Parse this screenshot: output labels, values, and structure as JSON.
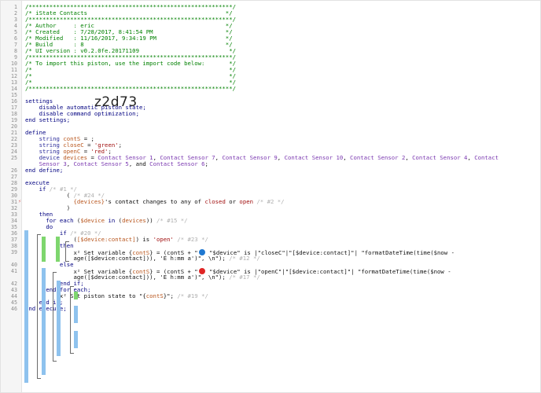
{
  "lines": [
    {
      "n": "1",
      "segs": [
        {
          "c": "cm",
          "t": "/***********************************************************/"
        }
      ]
    },
    {
      "n": "2",
      "segs": [
        {
          "c": "cm",
          "t": "/* iState Contacts                                        */"
        }
      ]
    },
    {
      "n": "3",
      "segs": [
        {
          "c": "cm",
          "t": "/***********************************************************/"
        }
      ]
    },
    {
      "n": "4",
      "segs": [
        {
          "c": "cm",
          "t": "/* Author     : eric                                      */"
        }
      ]
    },
    {
      "n": "5",
      "segs": [
        {
          "c": "cm",
          "t": "/* Created    : 7/28/2017, 8:41:54 PM                     */"
        }
      ]
    },
    {
      "n": "6",
      "segs": [
        {
          "c": "cm",
          "t": "/* Modified   : 11/16/2017, 9:34:19 PM                    */"
        }
      ]
    },
    {
      "n": "7",
      "segs": [
        {
          "c": "cm",
          "t": "/* Build      : 8                                         */"
        }
      ]
    },
    {
      "n": "8",
      "segs": [
        {
          "c": "cm",
          "t": "/* UI version : v0.2.0fe.20171109                          */"
        }
      ]
    },
    {
      "n": "9",
      "segs": [
        {
          "c": "cm",
          "t": "/***********************************************************/"
        }
      ]
    },
    {
      "n": "10",
      "segs": [
        {
          "c": "cm",
          "t": "/* To import this piston, use the import code below:       */"
        }
      ]
    },
    {
      "n": "11",
      "segs": [
        {
          "c": "cm",
          "t": "/*                                                         */"
        }
      ]
    },
    {
      "n": "12",
      "segs": [
        {
          "c": "cm",
          "t": "/*                                                         */"
        }
      ]
    },
    {
      "n": "13",
      "segs": [
        {
          "c": "cm",
          "t": "/*                                                         */"
        }
      ]
    },
    {
      "n": "14",
      "segs": [
        {
          "c": "cm",
          "t": "/***********************************************************/"
        }
      ]
    },
    {
      "n": "15",
      "segs": []
    },
    {
      "n": "16",
      "segs": [
        {
          "c": "kw",
          "t": "settings"
        }
      ]
    },
    {
      "n": "17",
      "segs": [
        {
          "c": "kw",
          "t": "    disable automatic piston state;"
        }
      ]
    },
    {
      "n": "18",
      "segs": [
        {
          "c": "kw",
          "t": "    disable command optimization;"
        }
      ]
    },
    {
      "n": "19",
      "segs": [
        {
          "c": "kw",
          "t": "end settings;"
        }
      ]
    },
    {
      "n": "20",
      "segs": []
    },
    {
      "n": "21",
      "segs": [
        {
          "c": "kw",
          "t": "define"
        }
      ]
    },
    {
      "n": "22",
      "segs": [
        {
          "c": "lit",
          "t": "    string "
        },
        {
          "c": "var",
          "t": "contS"
        },
        {
          "c": "plain",
          "t": " = ;"
        }
      ]
    },
    {
      "n": "23",
      "segs": [
        {
          "c": "lit",
          "t": "    string "
        },
        {
          "c": "var",
          "t": "closeC"
        },
        {
          "c": "plain",
          "t": " = "
        },
        {
          "c": "str",
          "t": "'green'"
        },
        {
          "c": "plain",
          "t": ";"
        }
      ]
    },
    {
      "n": "24",
      "segs": [
        {
          "c": "lit",
          "t": "    string "
        },
        {
          "c": "var",
          "t": "openC"
        },
        {
          "c": "plain",
          "t": " = "
        },
        {
          "c": "str",
          "t": "'red'"
        },
        {
          "c": "plain",
          "t": ";"
        }
      ]
    },
    {
      "n": "25",
      "segs": [
        {
          "c": "lit",
          "t": "    device "
        },
        {
          "c": "var",
          "t": "devices"
        },
        {
          "c": "plain",
          "t": " = "
        },
        {
          "c": "dev",
          "t": "Contact Sensor 1"
        },
        {
          "c": "plain",
          "t": ", "
        },
        {
          "c": "dev",
          "t": "Contact Sensor 7"
        },
        {
          "c": "plain",
          "t": ", "
        },
        {
          "c": "dev",
          "t": "Contact Sensor 9"
        },
        {
          "c": "plain",
          "t": ", "
        },
        {
          "c": "dev",
          "t": "Contact Sensor 10"
        },
        {
          "c": "plain",
          "t": ", "
        },
        {
          "c": "dev",
          "t": "Contact Sensor 2"
        },
        {
          "c": "plain",
          "t": ", "
        },
        {
          "c": "dev",
          "t": "Contact Sensor 4"
        },
        {
          "c": "plain",
          "t": ", "
        },
        {
          "c": "dev",
          "t": "Contact"
        }
      ]
    },
    {
      "n": "",
      "segs": [
        {
          "c": "dev",
          "t": "    Sensor 3"
        },
        {
          "c": "plain",
          "t": ", "
        },
        {
          "c": "dev",
          "t": "Contact Sensor 5"
        },
        {
          "c": "plain",
          "t": ", and "
        },
        {
          "c": "dev",
          "t": "Contact Sensor 6"
        },
        {
          "c": "plain",
          "t": ";"
        }
      ]
    },
    {
      "n": "26",
      "segs": [
        {
          "c": "kw",
          "t": "end define;"
        }
      ]
    },
    {
      "n": "27",
      "segs": []
    },
    {
      "n": "28",
      "segs": [
        {
          "c": "kw",
          "t": "execute"
        }
      ]
    },
    {
      "n": "29",
      "segs": [
        {
          "c": "kw",
          "t": "    if "
        },
        {
          "c": "dim",
          "t": "/* #1 */"
        }
      ]
    },
    {
      "n": "30",
      "segs": [
        {
          "c": "plain",
          "t": "            ( "
        },
        {
          "c": "dim",
          "t": "/* #24 */"
        }
      ]
    },
    {
      "n": "31",
      "segs": [
        {
          "c": "var",
          "t": "              {devices}"
        },
        {
          "c": "plain",
          "t": "'s "
        },
        {
          "c": "fn",
          "t": "contact"
        },
        {
          "c": "plain",
          "t": " changes to any of "
        },
        {
          "c": "str",
          "t": "closed"
        },
        {
          "c": "plain",
          "t": " or "
        },
        {
          "c": "str",
          "t": "open"
        },
        {
          "c": "dim",
          "t": " /* #2 */"
        }
      ]
    },
    {
      "n": "32",
      "segs": [
        {
          "c": "plain",
          "t": "            )"
        }
      ]
    },
    {
      "n": "33",
      "segs": [
        {
          "c": "kw",
          "t": "    then"
        }
      ]
    },
    {
      "n": "34",
      "segs": [
        {
          "c": "kw",
          "t": "      for each "
        },
        {
          "c": "plain",
          "t": "("
        },
        {
          "c": "var",
          "t": "$device"
        },
        {
          "c": "kw",
          "t": " in "
        },
        {
          "c": "plain",
          "t": "("
        },
        {
          "c": "var",
          "t": "devices"
        },
        {
          "c": "plain",
          "t": ")) "
        },
        {
          "c": "dim",
          "t": "/* #15 */"
        }
      ]
    },
    {
      "n": "35",
      "segs": [
        {
          "c": "kw",
          "t": "      do"
        }
      ]
    },
    {
      "n": "36",
      "segs": [
        {
          "c": "kw",
          "t": "          if "
        },
        {
          "c": "dim",
          "t": "/* #20 */"
        }
      ]
    },
    {
      "n": "37",
      "segs": [
        {
          "c": "plain",
          "t": "              ("
        },
        {
          "c": "var",
          "t": "[$device:contact]"
        },
        {
          "c": "plain",
          "t": ") is "
        },
        {
          "c": "str",
          "t": "'open'"
        },
        {
          "c": "dim",
          "t": " /* #23 */"
        }
      ]
    },
    {
      "n": "38",
      "segs": [
        {
          "c": "kw",
          "t": "          then"
        }
      ]
    },
    {
      "n": "39",
      "segs": [
        {
          "c": "plain",
          "t": "              x² Set variable {"
        },
        {
          "c": "var",
          "t": "contS"
        },
        {
          "c": "plain",
          "t": "} = (contS + \""
        },
        {
          "c": "dotb",
          "t": ""
        },
        {
          "c": "plain",
          "t": " \"$device\" is |\"closeC\"|\"[$device:contact]\"| \"formatDateTime(time($now -"
        }
      ]
    },
    {
      "n": "",
      "segs": [
        {
          "c": "plain",
          "t": "              age([$device:contact])), 'E h:mm a')\", \\n\"); "
        },
        {
          "c": "dim",
          "t": "/* #12 */"
        }
      ]
    },
    {
      "n": "40",
      "segs": [
        {
          "c": "kw",
          "t": "          else"
        }
      ]
    },
    {
      "n": "41",
      "segs": [
        {
          "c": "plain",
          "t": "              x² Set variable {"
        },
        {
          "c": "var",
          "t": "contS"
        },
        {
          "c": "plain",
          "t": "} = (contS + \""
        },
        {
          "c": "dotr",
          "t": ""
        },
        {
          "c": "plain",
          "t": " \"$device\" is |\"openC\"|\"[$device:contact]\"| \"formatDateTime(time($now -"
        }
      ]
    },
    {
      "n": "",
      "segs": [
        {
          "c": "plain",
          "t": "              age([$device:contact])), 'E h:mm a')\", \\n\"); "
        },
        {
          "c": "dim",
          "t": "/* #17 */"
        }
      ]
    },
    {
      "n": "42",
      "segs": [
        {
          "c": "kw",
          "t": "          end if;"
        }
      ]
    },
    {
      "n": "43",
      "segs": [
        {
          "c": "kw",
          "t": "      end for each;"
        }
      ]
    },
    {
      "n": "44",
      "segs": [
        {
          "c": "plain",
          "t": "          x² Set piston state to \"{"
        },
        {
          "c": "var",
          "t": "contS"
        },
        {
          "c": "plain",
          "t": "}\"; "
        },
        {
          "c": "dim",
          "t": "/* #19 */"
        }
      ]
    },
    {
      "n": "45",
      "segs": [
        {
          "c": "kw",
          "t": "    end if;"
        }
      ]
    },
    {
      "n": "46",
      "segs": [
        {
          "c": "kw",
          "t": "end execute;"
        }
      ]
    }
  ],
  "import_code": "z2d73",
  "breakpoint_marker": "⚡",
  "colors": {
    "green_bar": "#7ed66e",
    "blue_bar": "#8ec2ee",
    "blue_dot": "#1f78d1",
    "red_dot": "#e02626"
  }
}
